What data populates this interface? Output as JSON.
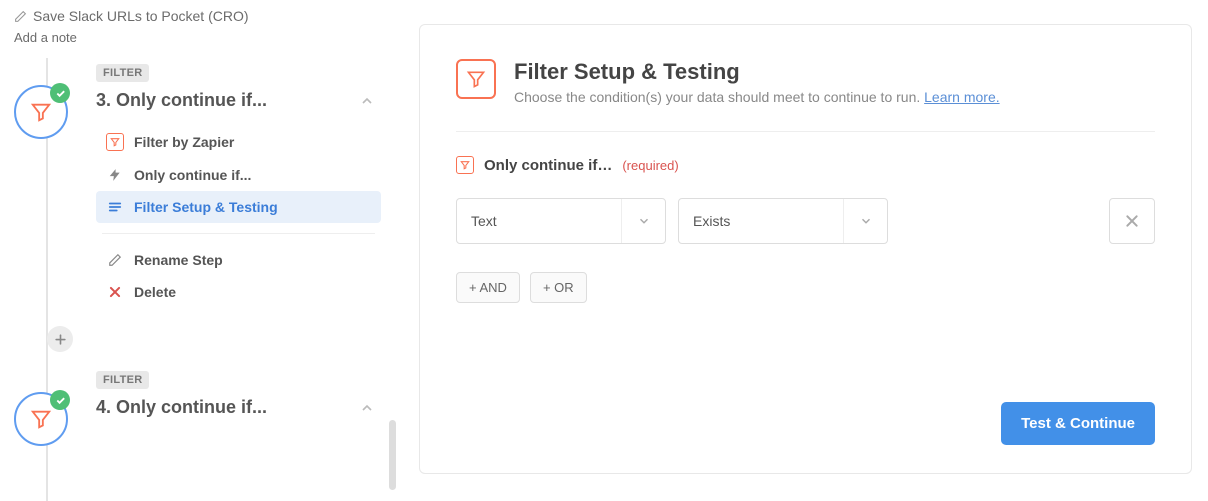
{
  "zap": {
    "title": "Save Slack URLs to Pocket (CRO)",
    "add_note": "Add a note"
  },
  "sidebar": {
    "steps": [
      {
        "badge": "FILTER",
        "title": "3. Only continue if...",
        "items": [
          {
            "label": "Filter by Zapier"
          },
          {
            "label": "Only continue if..."
          },
          {
            "label": "Filter Setup & Testing"
          },
          {
            "label": "Rename Step"
          },
          {
            "label": "Delete"
          }
        ]
      },
      {
        "badge": "FILTER",
        "title": "4. Only continue if..."
      }
    ]
  },
  "main": {
    "title": "Filter Setup & Testing",
    "subtitle": "Choose the condition(s) your data should meet to continue to run. ",
    "learn_more": "Learn more.",
    "section_title": "Only continue if…",
    "required_label": "(required)",
    "condition": {
      "field": "Text",
      "operator": "Exists"
    },
    "buttons": {
      "and": "+ AND",
      "or": "+ OR",
      "primary": "Test & Continue"
    }
  }
}
